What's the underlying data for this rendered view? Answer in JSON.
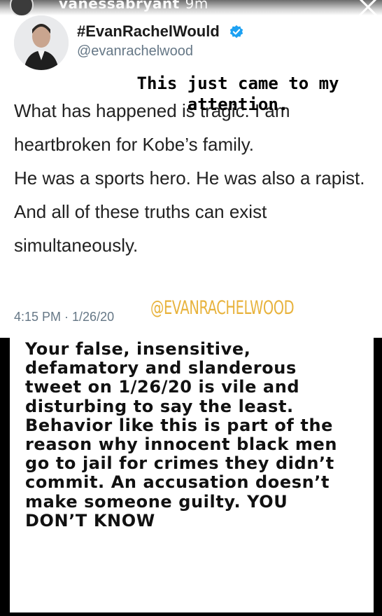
{
  "story": {
    "username": "vanessabryant",
    "time": "9m",
    "close_icon": "close-icon"
  },
  "tweet": {
    "display_name": "#EvanRachelWould",
    "handle": "@evanrachelwood",
    "verified_icon": "verified-badge-icon",
    "body": [
      "What has happened is tragic. I am heartbroken for Kobe’s family.",
      "He was a sports hero. He was also a rapist.",
      "And all of these truths can exist simultaneously."
    ],
    "timestamp": "4:15 PM · 1/26/20"
  },
  "overlay": {
    "note": "This just came to my attention.",
    "mention_sticker": "@EVANRACHELWOOD"
  },
  "response": {
    "text": "Your false, insensitive, defamatory and slanderous tweet on 1/26/20 is vile and disturbing to say the least. Behavior like this is part of the reason why innocent black men go to jail for crimes they didn’t commit. An accusation doesn’t make someone guilty. YOU DON’T KNOW"
  },
  "colors": {
    "verified": "#1da1f2",
    "mention_sticker": "#e8b33d",
    "handle": "#657786"
  }
}
